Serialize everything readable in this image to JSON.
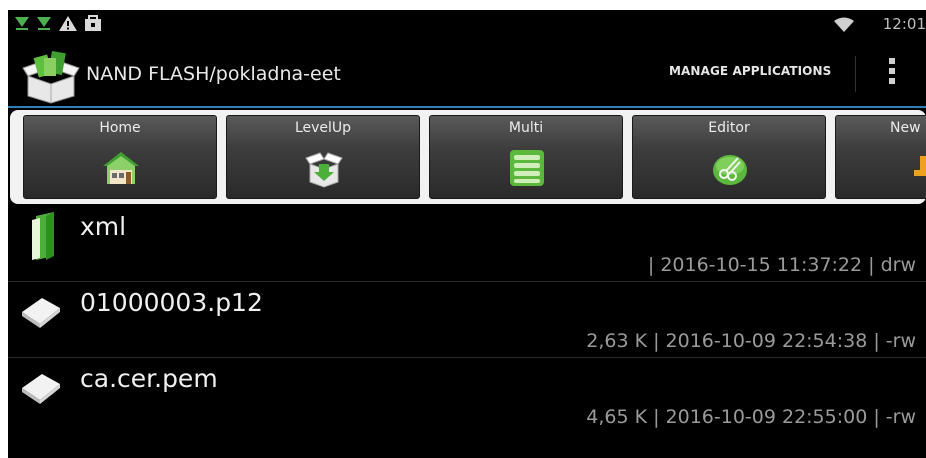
{
  "status_bar": {
    "icons": [
      "download-icon",
      "download-icon",
      "warning-icon",
      "shopping-bag-icon",
      "wifi-icon"
    ],
    "time": "12:01"
  },
  "action_bar": {
    "title": "NAND FLASH/pokladna-eet",
    "manage_button": "MANAGE APPLICATIONS",
    "overflow_icon": "overflow-menu-icon"
  },
  "toolbar": {
    "buttons": [
      {
        "label": "Home",
        "icon": "house-icon"
      },
      {
        "label": "LevelUp",
        "icon": "box-arrow-icon"
      },
      {
        "label": "Multi",
        "icon": "list-icon"
      },
      {
        "label": "Editor",
        "icon": "scissors-icon"
      },
      {
        "label": "New",
        "icon": "new-icon"
      }
    ]
  },
  "files": [
    {
      "name": "xml",
      "meta": "| 2016-10-15 11:37:22 | drw",
      "icon": "folder-icon"
    },
    {
      "name": "01000003.p12",
      "meta": "2,63 K | 2016-10-09 22:54:38 | -rw",
      "icon": "file-icon"
    },
    {
      "name": "ca.cer.pem",
      "meta": "4,65 K | 2016-10-09 22:55:00 | -rw",
      "icon": "file-icon"
    }
  ],
  "colors": {
    "accent_line": "#2f7fb0",
    "folder_green": "#4caf3a",
    "background": "#000000"
  }
}
